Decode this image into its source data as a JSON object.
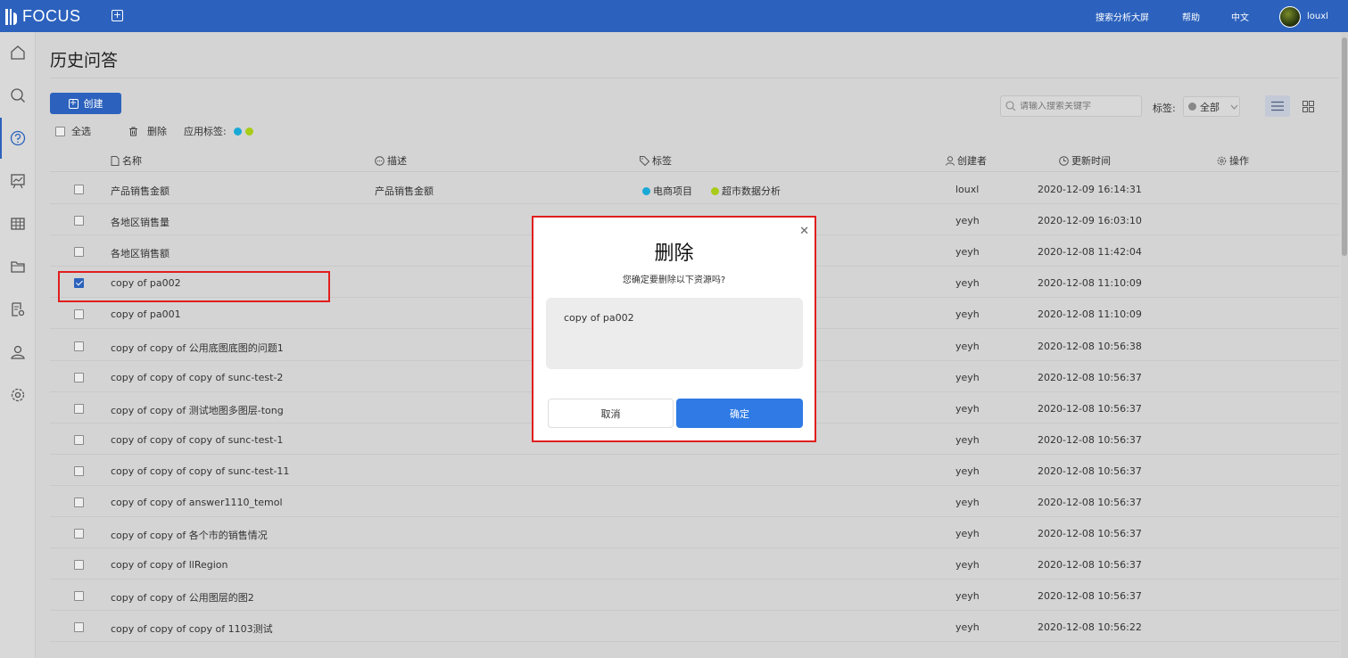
{
  "app": {
    "name": "FOCUS"
  },
  "topbar": {
    "links": [
      "搜索分析大屏",
      "帮助",
      "中文"
    ],
    "username": "louxl"
  },
  "sidebar": {
    "items": [
      {
        "icon": "home-icon",
        "active": false
      },
      {
        "icon": "search-icon",
        "active": false
      },
      {
        "icon": "question-icon",
        "active": true
      },
      {
        "icon": "dashboard-icon",
        "active": false
      },
      {
        "icon": "table-icon",
        "active": false
      },
      {
        "icon": "folder-icon",
        "active": false
      },
      {
        "icon": "report-settings-icon",
        "active": false
      },
      {
        "icon": "user-icon",
        "active": false
      },
      {
        "icon": "gear-icon",
        "active": false
      }
    ]
  },
  "page": {
    "title": "历史问答",
    "create_label": "创建",
    "select_all_label": "全选",
    "delete_label": "删除",
    "apply_tag_label": "应用标签:",
    "tag_colors": [
      "#1aa9d6",
      "#a8cc17"
    ],
    "search_placeholder": "请输入搜索关键字",
    "tag_filter_label": "标签:",
    "tag_filter_value": "全部"
  },
  "table": {
    "headers": {
      "name": "名称",
      "desc": "描述",
      "tags": "标签",
      "creator": "创建者",
      "updated": "更新时间",
      "actions": "操作"
    },
    "rows": [
      {
        "name": "产品销售金额",
        "desc": "产品销售金额",
        "tags": [
          {
            "label": "电商项目",
            "color": "#1aa9d6"
          },
          {
            "label": "超市数据分析",
            "color": "#a8cc17"
          }
        ],
        "creator": "louxl",
        "updated": "2020-12-09 16:14:31",
        "checked": false
      },
      {
        "name": "各地区销售量",
        "desc": "",
        "tags": [],
        "creator": "yeyh",
        "updated": "2020-12-09 16:03:10",
        "checked": false
      },
      {
        "name": "各地区销售额",
        "desc": "",
        "tags": [],
        "creator": "yeyh",
        "updated": "2020-12-08 11:42:04",
        "checked": false
      },
      {
        "name": "copy of pa002",
        "desc": "",
        "tags": [],
        "creator": "yeyh",
        "updated": "2020-12-08 11:10:09",
        "checked": true
      },
      {
        "name": "copy of pa001",
        "desc": "",
        "tags": [],
        "creator": "yeyh",
        "updated": "2020-12-08 11:10:09",
        "checked": false
      },
      {
        "name": "copy of copy of 公用底图底图的问题1",
        "desc": "",
        "tags": [],
        "creator": "yeyh",
        "updated": "2020-12-08 10:56:38",
        "checked": false
      },
      {
        "name": "copy of copy of copy of sunc-test-2",
        "desc": "",
        "tags": [],
        "creator": "yeyh",
        "updated": "2020-12-08 10:56:37",
        "checked": false
      },
      {
        "name": "copy of copy of 测试地图多图层-tong",
        "desc": "",
        "tags": [],
        "creator": "yeyh",
        "updated": "2020-12-08 10:56:37",
        "checked": false
      },
      {
        "name": "copy of copy of copy of sunc-test-1",
        "desc": "",
        "tags": [],
        "creator": "yeyh",
        "updated": "2020-12-08 10:56:37",
        "checked": false
      },
      {
        "name": "copy of copy of copy of sunc-test-11",
        "desc": "",
        "tags": [],
        "creator": "yeyh",
        "updated": "2020-12-08 10:56:37",
        "checked": false
      },
      {
        "name": "copy of copy of answer1110_temol",
        "desc": "",
        "tags": [],
        "creator": "yeyh",
        "updated": "2020-12-08 10:56:37",
        "checked": false
      },
      {
        "name": "copy of copy of 各个市的销售情况",
        "desc": "",
        "tags": [],
        "creator": "yeyh",
        "updated": "2020-12-08 10:56:37",
        "checked": false
      },
      {
        "name": "copy of copy of llRegion",
        "desc": "",
        "tags": [],
        "creator": "yeyh",
        "updated": "2020-12-08 10:56:37",
        "checked": false
      },
      {
        "name": "copy of copy of 公用图层的图2",
        "desc": "",
        "tags": [],
        "creator": "yeyh",
        "updated": "2020-12-08 10:56:37",
        "checked": false
      },
      {
        "name": "copy of copy of copy of 1103测试",
        "desc": "",
        "tags": [],
        "creator": "yeyh",
        "updated": "2020-12-08 10:56:22",
        "checked": false
      }
    ]
  },
  "modal": {
    "title": "删除",
    "subtitle": "您确定要删除以下资源吗?",
    "items": [
      "copy of pa002"
    ],
    "cancel_label": "取消",
    "confirm_label": "确定"
  },
  "colors": {
    "topbar": "#2c62bd",
    "primary_button": "#2f7ae5",
    "highlight_border": "#e01e1e"
  }
}
